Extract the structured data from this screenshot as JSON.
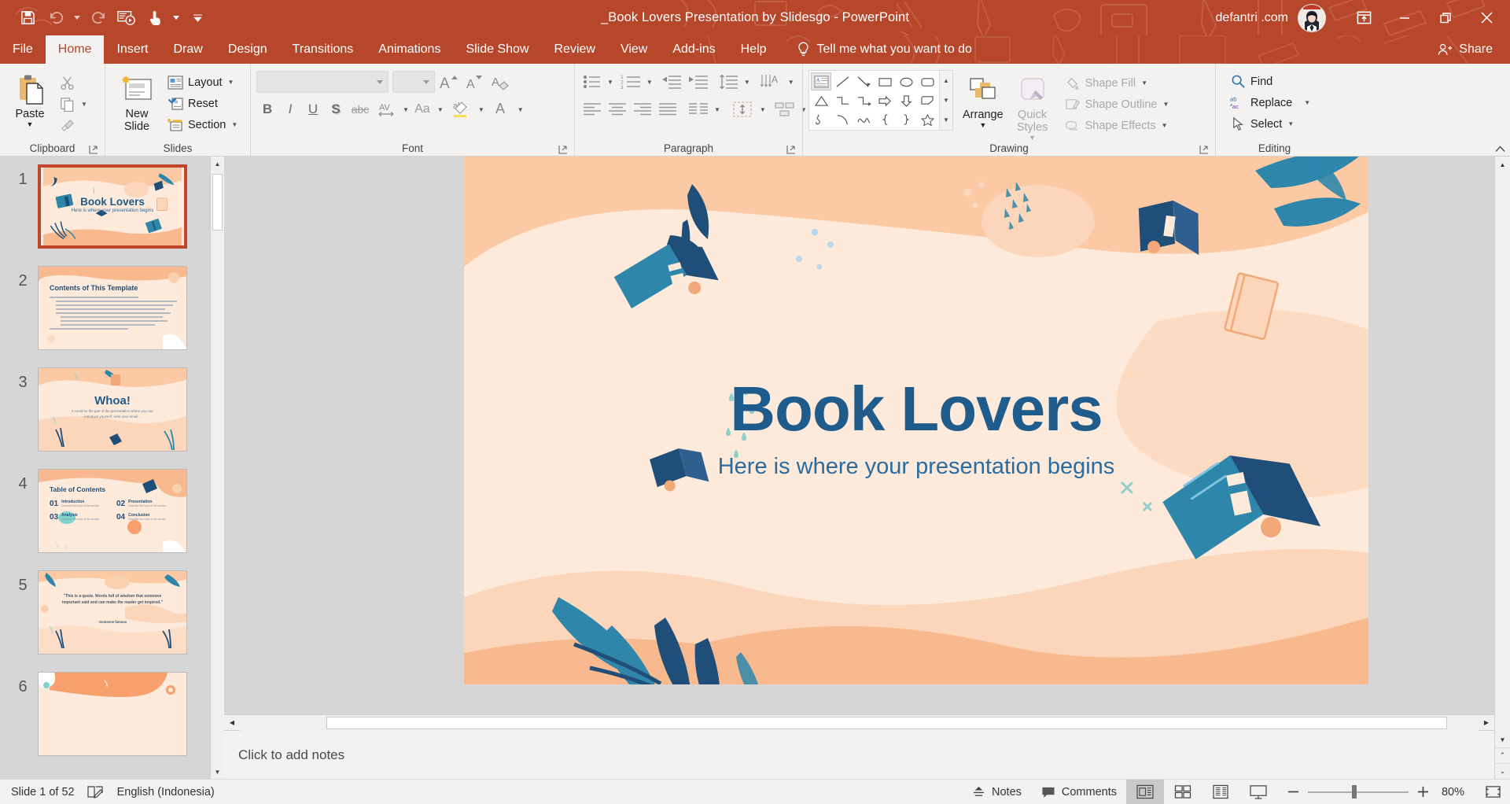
{
  "titlebar": {
    "document_title": "_Book Lovers Presentation by Slidesgo  -  PowerPoint",
    "user_name": "defantri .com",
    "quick_access": [
      {
        "name": "save",
        "label": "Save"
      },
      {
        "name": "undo",
        "label": "Undo"
      },
      {
        "name": "redo",
        "label": "Repeat"
      },
      {
        "name": "start-from-beginning",
        "label": "Start From Beginning"
      },
      {
        "name": "touch-mode",
        "label": "Touch/Mouse Mode"
      },
      {
        "name": "customize-qat",
        "label": "Customize Quick Access Toolbar"
      }
    ],
    "window_controls": [
      {
        "name": "ribbon-display-options",
        "label": "Ribbon Display Options"
      },
      {
        "name": "minimize",
        "label": "Minimize"
      },
      {
        "name": "restore",
        "label": "Restore Down"
      },
      {
        "name": "close",
        "label": "Close"
      }
    ]
  },
  "tabs": [
    {
      "label": "File",
      "active": false
    },
    {
      "label": "Home",
      "active": true
    },
    {
      "label": "Insert",
      "active": false
    },
    {
      "label": "Draw",
      "active": false
    },
    {
      "label": "Design",
      "active": false
    },
    {
      "label": "Transitions",
      "active": false
    },
    {
      "label": "Animations",
      "active": false
    },
    {
      "label": "Slide Show",
      "active": false
    },
    {
      "label": "Review",
      "active": false
    },
    {
      "label": "View",
      "active": false
    },
    {
      "label": "Add-ins",
      "active": false
    },
    {
      "label": "Help",
      "active": false
    }
  ],
  "tell_me": "Tell me what you want to do",
  "share_label": "Share",
  "ribbon": {
    "clipboard": {
      "group_label": "Clipboard",
      "paste_label": "Paste",
      "cut_label": "Cut",
      "copy_label": "Copy",
      "format_painter_label": "Format Painter"
    },
    "slides": {
      "group_label": "Slides",
      "new_slide_label_line1": "New",
      "new_slide_label_line2": "Slide",
      "layout_label": "Layout",
      "reset_label": "Reset",
      "section_label": "Section"
    },
    "font": {
      "group_label": "Font",
      "font_name_value": "",
      "font_size_value": "",
      "bold_label": "B",
      "italic_label": "I",
      "underline_label": "U",
      "shadow_label": "S",
      "strikethrough_label": "abc",
      "character_spacing_label": "AV",
      "change_case_label": "Aa",
      "increase_font_label": "A",
      "decrease_font_label": "A",
      "clear_formatting_label": "A",
      "text_highlight_label": "ab",
      "font_color_label": "A"
    },
    "paragraph": {
      "group_label": "Paragraph",
      "bullets_label": "Bullets",
      "numbering_label": "Numbering",
      "decrease_indent_label": "Decrease List Level",
      "increase_indent_label": "Increase List Level",
      "line_spacing_label": "Line Spacing",
      "text_direction_label": "Text Direction",
      "align_text_label": "Align Text",
      "align_left_label": "Align Left",
      "align_center_label": "Center",
      "align_right_label": "Align Right",
      "justify_label": "Justify",
      "columns_label": "Columns",
      "convert_smartart_label": "Convert to SmartArt"
    },
    "drawing": {
      "group_label": "Drawing",
      "arrange_label": "Arrange",
      "quick_styles_line1": "Quick",
      "quick_styles_line2": "Styles",
      "shape_fill_label": "Shape Fill",
      "shape_outline_label": "Shape Outline",
      "shape_effects_label": "Shape Effects",
      "shapes": [
        "text-box",
        "line",
        "arrow",
        "rectangle",
        "oval",
        "rounded-rectangle",
        "isosceles-triangle",
        "elbow-connector",
        "elbow-arrow-connector",
        "right-arrow",
        "down-arrow",
        "folded-corner",
        "scribble",
        "arc",
        "curve",
        "left-brace",
        "right-brace",
        "star"
      ]
    },
    "editing": {
      "group_label": "Editing",
      "find_label": "Find",
      "replace_label": "Replace",
      "select_label": "Select"
    }
  },
  "thumbnails": [
    {
      "number": "1",
      "title": "Book Lovers",
      "subtitle": "Here is where your presentation begins",
      "selected": true
    },
    {
      "number": "2",
      "title": "Contents of This Template",
      "subtitle": "",
      "selected": false
    },
    {
      "number": "3",
      "title": "Whoa!",
      "subtitle": "It could be the part of the presentation where you can introduce yourself, write your email...",
      "selected": false
    },
    {
      "number": "4",
      "title": "Table of Contents",
      "subtitle": "",
      "selected": false,
      "toc": [
        {
          "num": "01",
          "name": "Introduction",
          "desc": "Describe the topic of the section"
        },
        {
          "num": "02",
          "name": "Presentation",
          "desc": "Describe the topic of the section"
        },
        {
          "num": "03",
          "name": "Analysis",
          "desc": "Describe the topic of the section"
        },
        {
          "num": "04",
          "name": "Conclusion",
          "desc": "Describe the topic of the section"
        }
      ]
    },
    {
      "number": "5",
      "title": "",
      "subtitle": "\"This is a quote. Words full of wisdom that someone important said and can make the reader get inspired.\"",
      "attribution": "-Someone famous",
      "selected": false
    },
    {
      "number": "6",
      "title": "",
      "subtitle": "",
      "selected": false
    }
  ],
  "slide": {
    "title": "Book Lovers",
    "subtitle": "Here is where your presentation begins",
    "title_color": "#1f5c8b",
    "background_color": "#fdeadb"
  },
  "notes_placeholder": "Click to add notes",
  "status": {
    "slide_counter": "Slide 1 of 52",
    "language": "English (Indonesia)",
    "notes_label": "Notes",
    "comments_label": "Comments",
    "zoom_level": "80%",
    "views": [
      {
        "name": "normal-view",
        "label": "Normal",
        "active": true
      },
      {
        "name": "slide-sorter-view",
        "label": "Slide Sorter",
        "active": false
      },
      {
        "name": "reading-view",
        "label": "Reading View",
        "active": false
      },
      {
        "name": "slide-show-view",
        "label": "Slide Show",
        "active": false
      }
    ],
    "zoom_out_label": "Zoom Out",
    "zoom_in_label": "Zoom In",
    "fit_slide_label": "Fit slide to current window"
  },
  "accent_color": "#b7472a"
}
